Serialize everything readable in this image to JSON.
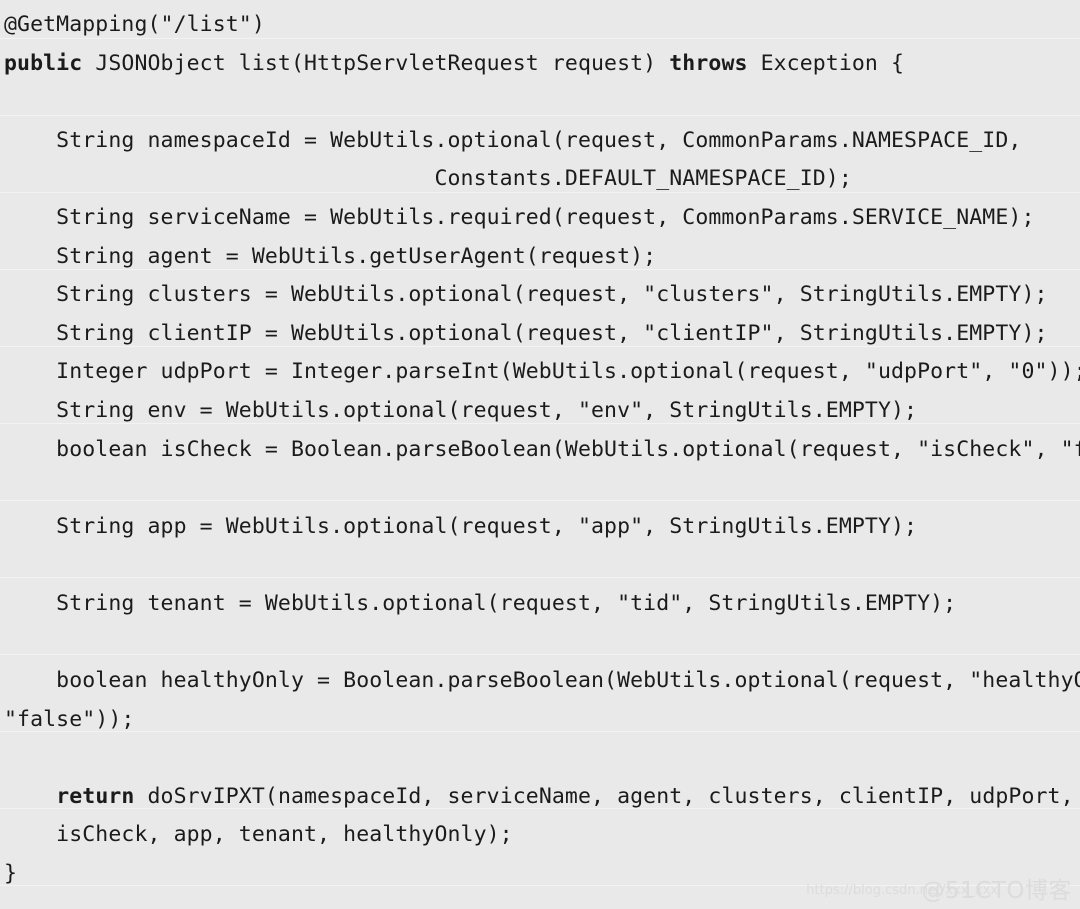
{
  "code_block": {
    "language": "java",
    "background_color": "#e9e9e9",
    "text_color": "#1b1b1b",
    "lines": [
      {
        "indent": 0,
        "segments": [
          {
            "text": "@GetMapping(\"/list\")",
            "bold": false
          }
        ]
      },
      {
        "indent": 0,
        "segments": [
          {
            "text": "public ",
            "bold": true
          },
          {
            "text": "JSONObject list(HttpServletRequest request) ",
            "bold": false
          },
          {
            "text": "throws ",
            "bold": true
          },
          {
            "text": "Exception {",
            "bold": false
          }
        ]
      },
      {
        "indent": 0,
        "segments": [
          {
            "text": "",
            "bold": false
          }
        ]
      },
      {
        "indent": 0,
        "segments": [
          {
            "text": "    String namespaceId = WebUtils.optional(request, CommonParams.NAMESPACE_ID,",
            "bold": false
          }
        ]
      },
      {
        "indent": 0,
        "segments": [
          {
            "text": "                                 Constants.DEFAULT_NAMESPACE_ID);",
            "bold": false
          }
        ]
      },
      {
        "indent": 0,
        "segments": [
          {
            "text": "    String serviceName = WebUtils.required(request, CommonParams.SERVICE_NAME);",
            "bold": false
          }
        ]
      },
      {
        "indent": 0,
        "segments": [
          {
            "text": "    String agent = WebUtils.getUserAgent(request);",
            "bold": false
          }
        ]
      },
      {
        "indent": 0,
        "segments": [
          {
            "text": "    String clusters = WebUtils.optional(request, \"clusters\", StringUtils.EMPTY);",
            "bold": false
          }
        ]
      },
      {
        "indent": 0,
        "segments": [
          {
            "text": "    String clientIP = WebUtils.optional(request, \"clientIP\", StringUtils.EMPTY);",
            "bold": false
          }
        ]
      },
      {
        "indent": 0,
        "segments": [
          {
            "text": "    Integer udpPort = Integer.parseInt(WebUtils.optional(request, \"udpPort\", \"0\"));",
            "bold": false
          }
        ]
      },
      {
        "indent": 0,
        "segments": [
          {
            "text": "    String env = WebUtils.optional(request, \"env\", StringUtils.EMPTY);",
            "bold": false
          }
        ]
      },
      {
        "indent": 0,
        "segments": [
          {
            "text": "    boolean isCheck = Boolean.parseBoolean(WebUtils.optional(request, \"isCheck\", \"false\"));",
            "bold": false
          }
        ]
      },
      {
        "indent": 0,
        "segments": [
          {
            "text": "",
            "bold": false
          }
        ]
      },
      {
        "indent": 0,
        "segments": [
          {
            "text": "    String app = WebUtils.optional(request, \"app\", StringUtils.EMPTY);",
            "bold": false
          }
        ]
      },
      {
        "indent": 0,
        "segments": [
          {
            "text": "",
            "bold": false
          }
        ]
      },
      {
        "indent": 0,
        "segments": [
          {
            "text": "    String tenant = WebUtils.optional(request, \"tid\", StringUtils.EMPTY);",
            "bold": false
          }
        ]
      },
      {
        "indent": 0,
        "segments": [
          {
            "text": "",
            "bold": false
          }
        ]
      },
      {
        "indent": 0,
        "segments": [
          {
            "text": "    boolean healthyOnly = Boolean.parseBoolean(WebUtils.optional(request, \"healthyOnly\",",
            "bold": false
          }
        ]
      },
      {
        "indent": 0,
        "segments": [
          {
            "text": "\"false\"));",
            "bold": false
          }
        ]
      },
      {
        "indent": 0,
        "segments": [
          {
            "text": "",
            "bold": false
          }
        ]
      },
      {
        "indent": 0,
        "segments": [
          {
            "text": "    ",
            "bold": false
          },
          {
            "text": "return ",
            "bold": true
          },
          {
            "text": "doSrvIPXT(namespaceId, serviceName, agent, clusters, clientIP, udpPort, env,",
            "bold": false
          }
        ]
      },
      {
        "indent": 0,
        "segments": [
          {
            "text": "    isCheck, app, tenant, healthyOnly);",
            "bold": false
          }
        ]
      },
      {
        "indent": 0,
        "segments": [
          {
            "text": "}",
            "bold": false
          }
        ]
      }
    ]
  },
  "watermark": {
    "url_text": "https://blog.csdn.net/xxx_xxx",
    "brand_text": "@51CTO博客",
    "color": "#dcdcdc"
  }
}
